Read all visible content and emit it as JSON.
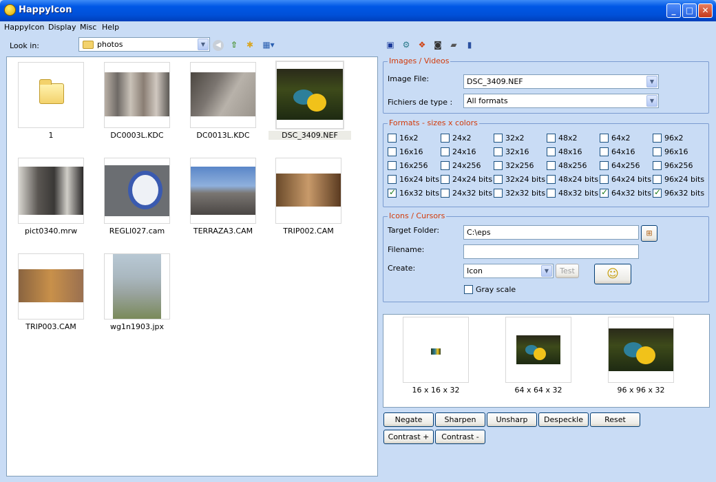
{
  "window": {
    "title": "HappyIcon",
    "minimize": "_",
    "maximize": "□",
    "close": "✕"
  },
  "menu": [
    "HappyIcon",
    "Display",
    "Misc",
    "Help"
  ],
  "browser": {
    "look_in_label": "Look in:",
    "folder": "photos",
    "files": [
      {
        "name": "1"
      },
      {
        "name": "DC0003L.KDC"
      },
      {
        "name": "DC0013L.KDC"
      },
      {
        "name": "DSC_3409.NEF"
      },
      {
        "name": "pict0340.mrw"
      },
      {
        "name": "REGLI027.cam"
      },
      {
        "name": "TERRAZA3.CAM"
      },
      {
        "name": "TRIP002.CAM"
      },
      {
        "name": "TRIP003.CAM"
      },
      {
        "name": "wg1n1903.jpx"
      }
    ]
  },
  "images_group": {
    "title": "Images / Videos",
    "image_file_label": "Image File:",
    "image_file_value": "DSC_3409.NEF",
    "type_label": "Fichiers de type :",
    "type_value": "All formats"
  },
  "formats_group": {
    "title": "Formats - sizes x colors",
    "rows": [
      [
        {
          "label": "16x2",
          "checked": false
        },
        {
          "label": "24x2",
          "checked": false
        },
        {
          "label": "32x2",
          "checked": false
        },
        {
          "label": "48x2",
          "checked": false
        },
        {
          "label": "64x2",
          "checked": false
        },
        {
          "label": "96x2",
          "checked": false
        }
      ],
      [
        {
          "label": "16x16",
          "checked": false
        },
        {
          "label": "24x16",
          "checked": false
        },
        {
          "label": "32x16",
          "checked": false
        },
        {
          "label": "48x16",
          "checked": false
        },
        {
          "label": "64x16",
          "checked": false
        },
        {
          "label": "96x16",
          "checked": false
        }
      ],
      [
        {
          "label": "16x256",
          "checked": false
        },
        {
          "label": "24x256",
          "checked": false
        },
        {
          "label": "32x256",
          "checked": false
        },
        {
          "label": "48x256",
          "checked": false
        },
        {
          "label": "64x256",
          "checked": false
        },
        {
          "label": "96x256",
          "checked": false
        }
      ],
      [
        {
          "label": "16x24 bits",
          "checked": false
        },
        {
          "label": "24x24 bits",
          "checked": false
        },
        {
          "label": "32x24 bits",
          "checked": false
        },
        {
          "label": "48x24 bits",
          "checked": false
        },
        {
          "label": "64x24 bits",
          "checked": false
        },
        {
          "label": "96x24 bits",
          "checked": false
        }
      ],
      [
        {
          "label": "16x32 bits",
          "checked": true
        },
        {
          "label": "24x32 bits",
          "checked": false
        },
        {
          "label": "32x32 bits",
          "checked": false
        },
        {
          "label": "48x32 bits",
          "checked": false
        },
        {
          "label": "64x32 bits",
          "checked": true
        },
        {
          "label": "96x32 bits",
          "checked": true
        }
      ]
    ]
  },
  "icons_group": {
    "title": "Icons / Cursors",
    "target_label": "Target Folder:",
    "target_value": "C:\\eps",
    "filename_label": "Filename:",
    "filename_value": "",
    "create_label": "Create:",
    "create_value": "Icon",
    "test_label": "Test",
    "gray_label": "Gray scale",
    "gray_checked": false
  },
  "previews": [
    {
      "label": "16 x 16 x 32"
    },
    {
      "label": "64 x 64 x 32"
    },
    {
      "label": "96 x 96 x 32"
    }
  ],
  "actions": {
    "negate": "Negate",
    "sharpen": "Sharpen",
    "unsharp": "Unsharp",
    "despeckle": "Despeckle",
    "reset": "Reset",
    "contrast_plus": "Contrast +",
    "contrast_minus": "Contrast -"
  },
  "colors": {
    "title_bar": "#0054e3",
    "group_title": "#d23a0a",
    "background": "#c9dcf5"
  }
}
